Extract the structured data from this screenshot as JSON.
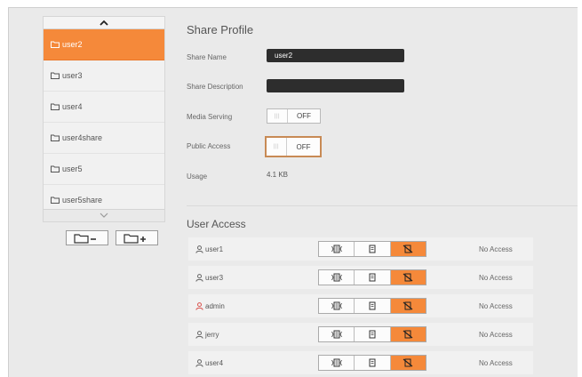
{
  "shares": {
    "items": [
      {
        "label": "user2",
        "selected": true
      },
      {
        "label": "user3",
        "selected": false
      },
      {
        "label": "user4",
        "selected": false
      },
      {
        "label": "user4share",
        "selected": false
      },
      {
        "label": "user5",
        "selected": false
      },
      {
        "label": "user5share",
        "selected": false
      }
    ],
    "scroll_up_icon": "chevron-up-icon",
    "scroll_down_icon": "chevron-down-icon",
    "remove_share_icon": "folder-minus-icon",
    "add_share_icon": "folder-plus-icon"
  },
  "profile": {
    "title": "Share Profile",
    "share_name_label": "Share Name",
    "share_name_value": "user2",
    "share_description_label": "Share Description",
    "share_description_value": "",
    "media_serving_label": "Media Serving",
    "media_serving_state": "OFF",
    "public_access_label": "Public Access",
    "public_access_state": "OFF",
    "usage_label": "Usage",
    "usage_value": "4.1 KB"
  },
  "user_access": {
    "title": "User Access",
    "users": [
      {
        "name": "user1",
        "status": "No Access",
        "admin": false
      },
      {
        "name": "user3",
        "status": "No Access",
        "admin": false
      },
      {
        "name": "admin",
        "status": "No Access",
        "admin": true
      },
      {
        "name": "jerry",
        "status": "No Access",
        "admin": false
      },
      {
        "name": "user4",
        "status": "No Access",
        "admin": false
      }
    ],
    "access_icons": [
      "read-write-icon",
      "read-only-icon",
      "no-access-icon"
    ]
  },
  "colors": {
    "accent": "#f5893a",
    "admin_icon": "#d9534f",
    "input_bg": "#2d2d2d"
  }
}
